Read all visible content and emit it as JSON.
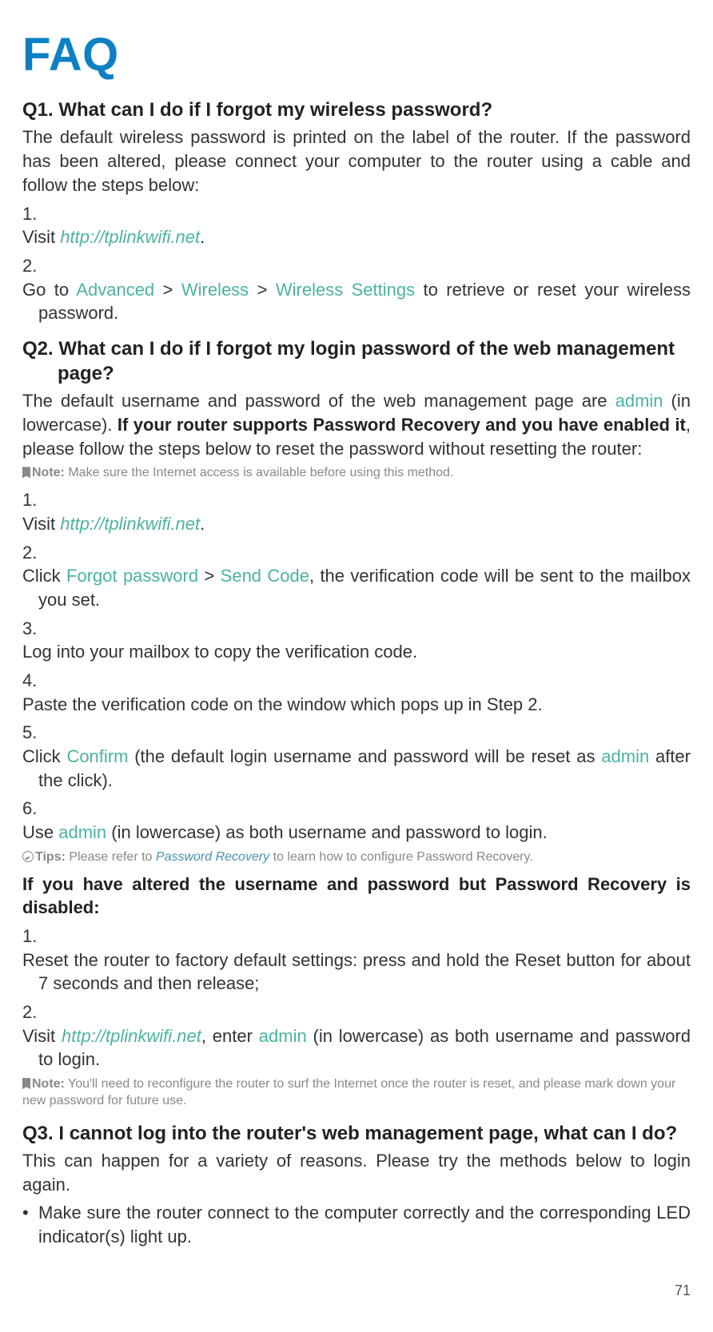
{
  "title": "FAQ",
  "q1": {
    "heading": "Q1. What can I do if I forgot my wireless password?",
    "intro": "The default wireless password is printed on the label of the router. If the password has been altered, please connect your computer to the router using a cable and follow the steps below:",
    "step1_pre": "Visit ",
    "step1_link": "http://tplinkwifi.net",
    "step1_post": ".",
    "step2_pre": "Go to ",
    "step2_u1": "Advanced",
    "step2_s1": " > ",
    "step2_u2": "Wireless",
    "step2_s2": " > ",
    "step2_u3": "Wireless Settings",
    "step2_post": " to retrieve or reset your wireless password."
  },
  "q2": {
    "heading_line1": "Q2. What can I do if I forgot my login password of the web management",
    "heading_line2": "page?",
    "intro_pre": "The default username and password of the web management page are ",
    "intro_admin": "admin",
    "intro_mid": " (in lowercase). ",
    "intro_bold": "If your router supports Password Recovery and you have enabled it",
    "intro_post": ", please follow the steps below to reset the password without resetting the router:",
    "note1_label": "Note:",
    "note1_text": " Make sure the Internet access is available before using this method.",
    "s1_pre": "Visit ",
    "s1_link": "http://tplinkwifi.net",
    "s1_post": ".",
    "s2_pre": "Click ",
    "s2_u1": "Forgot password",
    "s2_s1": " > ",
    "s2_u2": "Send Code",
    "s2_post": ", the verification code will be sent to the mailbox you set.",
    "s3": "Log into your mailbox to copy the verification code.",
    "s4": "Paste the verification code on the window which pops up in Step 2.",
    "s5_pre": "Click ",
    "s5_u1": "Confirm",
    "s5_mid": " (the default login username and password will be reset as ",
    "s5_admin": "admin",
    "s5_post": " after the click).",
    "s6_pre": "Use ",
    "s6_admin": "admin",
    "s6_post": " (in lowercase) as both username and password to login.",
    "tips_label": "Tips:",
    "tips_pre": " Please refer to ",
    "tips_link": "Password Recovery",
    "tips_post": " to learn how to configure Password Recovery.",
    "altHeading": "If you have altered the username and password but Password Recovery is disabled:",
    "alt1": "Reset the router to factory default settings: press and hold the Reset button for about 7 seconds and then release;",
    "alt2_pre": "Visit ",
    "alt2_link": "http://tplinkwifi.net",
    "alt2_mid": ", enter ",
    "alt2_admin": "admin",
    "alt2_post": " (in lowercase) as both username and password to login.",
    "note2_label": "Note:",
    "note2_text": " You'll need to reconfigure the router to surf the Internet once the router is reset, and please mark down your new password for future use."
  },
  "q3": {
    "heading": "Q3. I cannot log into the router's web management page, what can I do?",
    "intro": "This can happen for a variety of reasons. Please try the methods below to login again.",
    "b1": "Make sure the router connect to the computer correctly and the corresponding LED indicator(s) light up."
  },
  "pageNumber": "71"
}
